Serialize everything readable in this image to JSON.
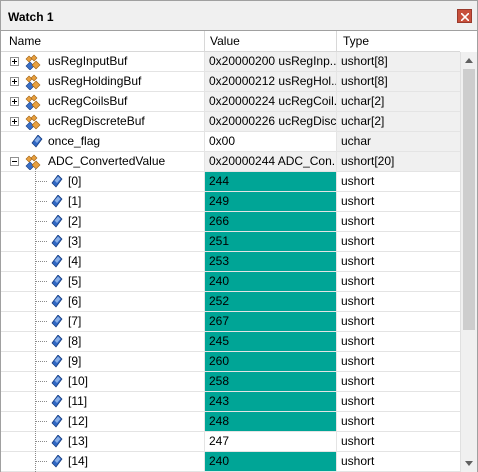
{
  "window": {
    "title": "Watch 1"
  },
  "columns": {
    "name": "Name",
    "value": "Value",
    "type": "Type"
  },
  "colors": {
    "highlight": "#00a596",
    "struct_icon_orange": "#e8a040",
    "struct_icon_blue": "#3a6fc7",
    "leaf_icon_blue": "#2f67c4"
  },
  "variables": [
    {
      "name": "usRegInputBuf",
      "value": "0x20000200 usRegInp...",
      "type": "ushort[8]",
      "kind": "struct",
      "expander": "+"
    },
    {
      "name": "usRegHoldingBuf",
      "value": "0x20000212 usRegHol...",
      "type": "ushort[8]",
      "kind": "struct",
      "expander": "+"
    },
    {
      "name": "ucRegCoilsBuf",
      "value": "0x20000224 ucRegCoil...",
      "type": "uchar[2]",
      "kind": "struct",
      "expander": "+"
    },
    {
      "name": "ucRegDiscreteBuf",
      "value": "0x20000226 ucRegDisc...",
      "type": "uchar[2]",
      "kind": "struct",
      "expander": "+"
    },
    {
      "name": "once_flag",
      "value": "0x00",
      "type": "uchar",
      "kind": "leaf",
      "expander": ""
    },
    {
      "name": "ADC_ConvertedValue",
      "value": "0x20000244 ADC_Con...",
      "type": "ushort[20]",
      "kind": "struct",
      "expander": "-"
    }
  ],
  "adc_elements": [
    {
      "index": "[0]",
      "value": "244",
      "type": "ushort",
      "changed": true
    },
    {
      "index": "[1]",
      "value": "249",
      "type": "ushort",
      "changed": true
    },
    {
      "index": "[2]",
      "value": "266",
      "type": "ushort",
      "changed": true
    },
    {
      "index": "[3]",
      "value": "251",
      "type": "ushort",
      "changed": true
    },
    {
      "index": "[4]",
      "value": "253",
      "type": "ushort",
      "changed": true
    },
    {
      "index": "[5]",
      "value": "240",
      "type": "ushort",
      "changed": true
    },
    {
      "index": "[6]",
      "value": "252",
      "type": "ushort",
      "changed": true
    },
    {
      "index": "[7]",
      "value": "267",
      "type": "ushort",
      "changed": true
    },
    {
      "index": "[8]",
      "value": "245",
      "type": "ushort",
      "changed": true
    },
    {
      "index": "[9]",
      "value": "260",
      "type": "ushort",
      "changed": true
    },
    {
      "index": "[10]",
      "value": "258",
      "type": "ushort",
      "changed": true
    },
    {
      "index": "[11]",
      "value": "243",
      "type": "ushort",
      "changed": true
    },
    {
      "index": "[12]",
      "value": "248",
      "type": "ushort",
      "changed": true
    },
    {
      "index": "[13]",
      "value": "247",
      "type": "ushort",
      "changed": false
    },
    {
      "index": "[14]",
      "value": "240",
      "type": "ushort",
      "changed": true
    }
  ],
  "icons": {
    "close": "close-icon",
    "struct": "struct-variable-icon",
    "leaf": "variable-diamond-icon",
    "scroll_up": "scroll-up-arrow-icon",
    "scroll_down": "scroll-down-arrow-icon"
  }
}
